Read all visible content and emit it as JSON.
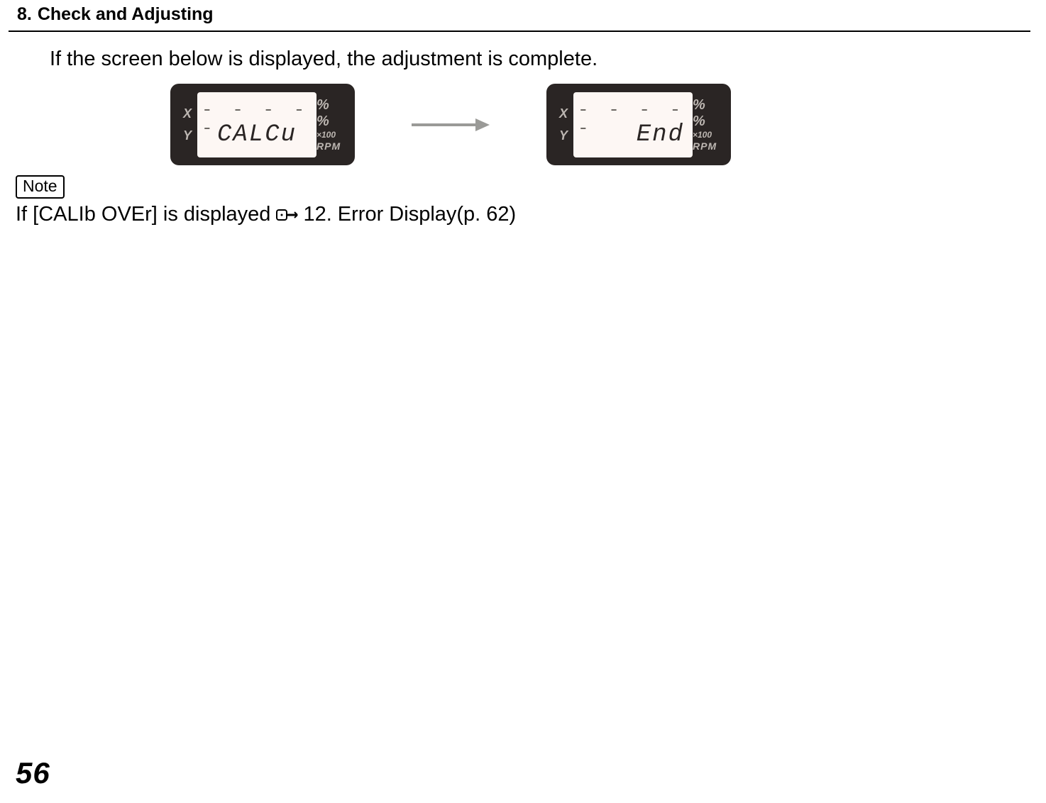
{
  "header": {
    "section_number": "8.",
    "section_title": "Check and Adjusting"
  },
  "intro_text": "If the screen below is displayed, the adjustment is complete.",
  "lcd_left": {
    "labels_left": {
      "x": "X",
      "y": "Y"
    },
    "row1": "- - - - -",
    "row2": "CALCu",
    "right": {
      "pct1": "%",
      "pct2": "%",
      "x100": "×100",
      "rpm": "RPM"
    }
  },
  "lcd_right": {
    "labels_left": {
      "x": "X",
      "y": "Y"
    },
    "row1": "- - - - -",
    "row2": "End",
    "right": {
      "pct1": "%",
      "pct2": "%",
      "x100": "×100",
      "rpm": "RPM"
    }
  },
  "note_label": "Note",
  "note_text_parts": {
    "pre": "If [CALIb OVEr] is displayed ",
    "post": "12. Error Display(p. 62)"
  },
  "page_number": "56"
}
